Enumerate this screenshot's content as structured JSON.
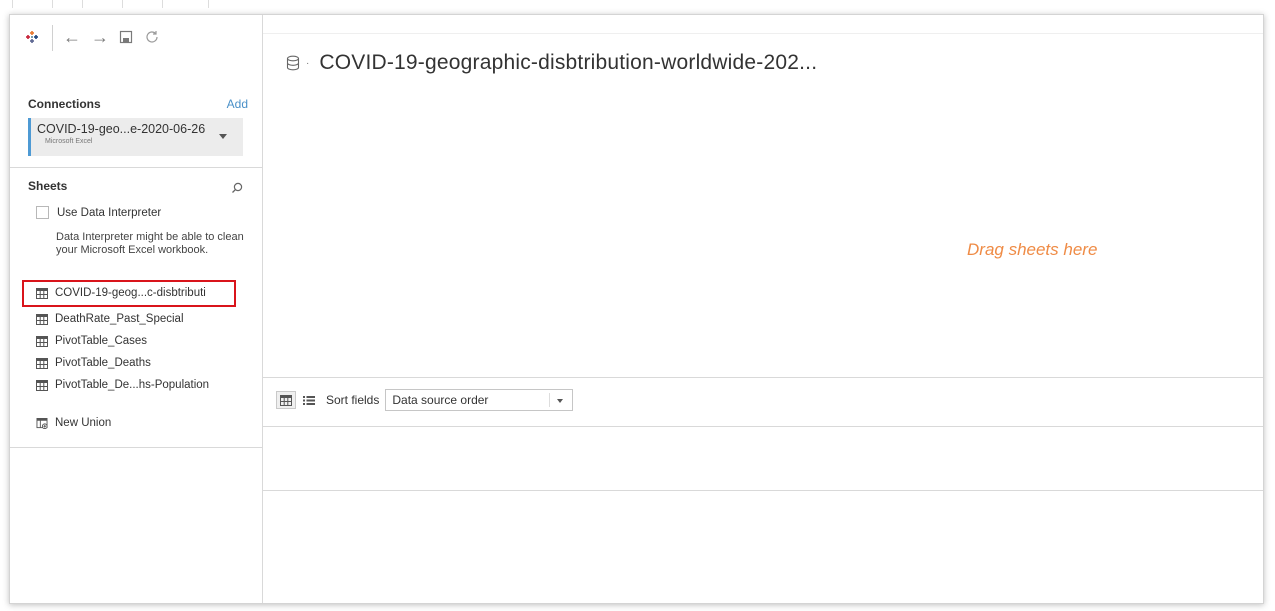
{
  "toolbar": {
    "icons": [
      "tableau-logo-icon",
      "back-arrow-icon",
      "forward-arrow-icon",
      "save-icon",
      "refresh-icon"
    ],
    "back_glyph": "←",
    "forward_glyph": "→"
  },
  "connections": {
    "title": "Connections",
    "add_label": "Add",
    "item": {
      "name": "COVID-19-geo...e-2020-06-26",
      "type": "Microsoft Excel"
    }
  },
  "sheets": {
    "title": "Sheets",
    "interpreter_label": "Use Data Interpreter",
    "interpreter_checked": false,
    "interpreter_description": "Data Interpreter might be able to clean your Microsoft Excel workbook.",
    "items": [
      {
        "label": "COVID-19-geog...c-disbtributi",
        "selected": true
      },
      {
        "label": "DeathRate_Past_Special"
      },
      {
        "label": "PivotTable_Cases"
      },
      {
        "label": "PivotTable_Deaths"
      },
      {
        "label": "PivotTable_De...hs-Population"
      }
    ],
    "new_union_label": "New Union"
  },
  "main": {
    "datasource_title": "COVID-19-geographic-disbtribution-worldwide-202...",
    "drag_hint": "Drag sheets here",
    "sort_label": "Sort fields",
    "sort_value": "Data source order"
  },
  "colors": {
    "accent": "#4e9ad4",
    "hint": "#ef8b45",
    "highlight": "#d9141b"
  }
}
